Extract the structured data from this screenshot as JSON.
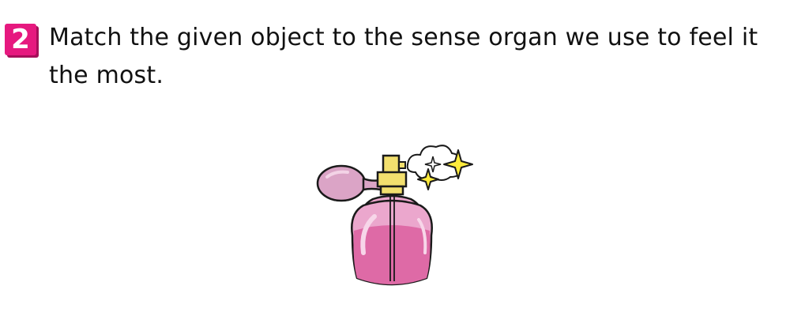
{
  "question": {
    "number": "2",
    "text": "Match the given object to the sense organ we use to feel it the most."
  },
  "illustration": {
    "subject": "perfume-bottle",
    "colors": {
      "bottle": "#e890c2",
      "liquid": "#de6aa6",
      "bulb": "#dba4c6",
      "cap": "#f2df6e",
      "sparkle": "#ffeb3b",
      "outline": "#1a1a1a"
    }
  }
}
